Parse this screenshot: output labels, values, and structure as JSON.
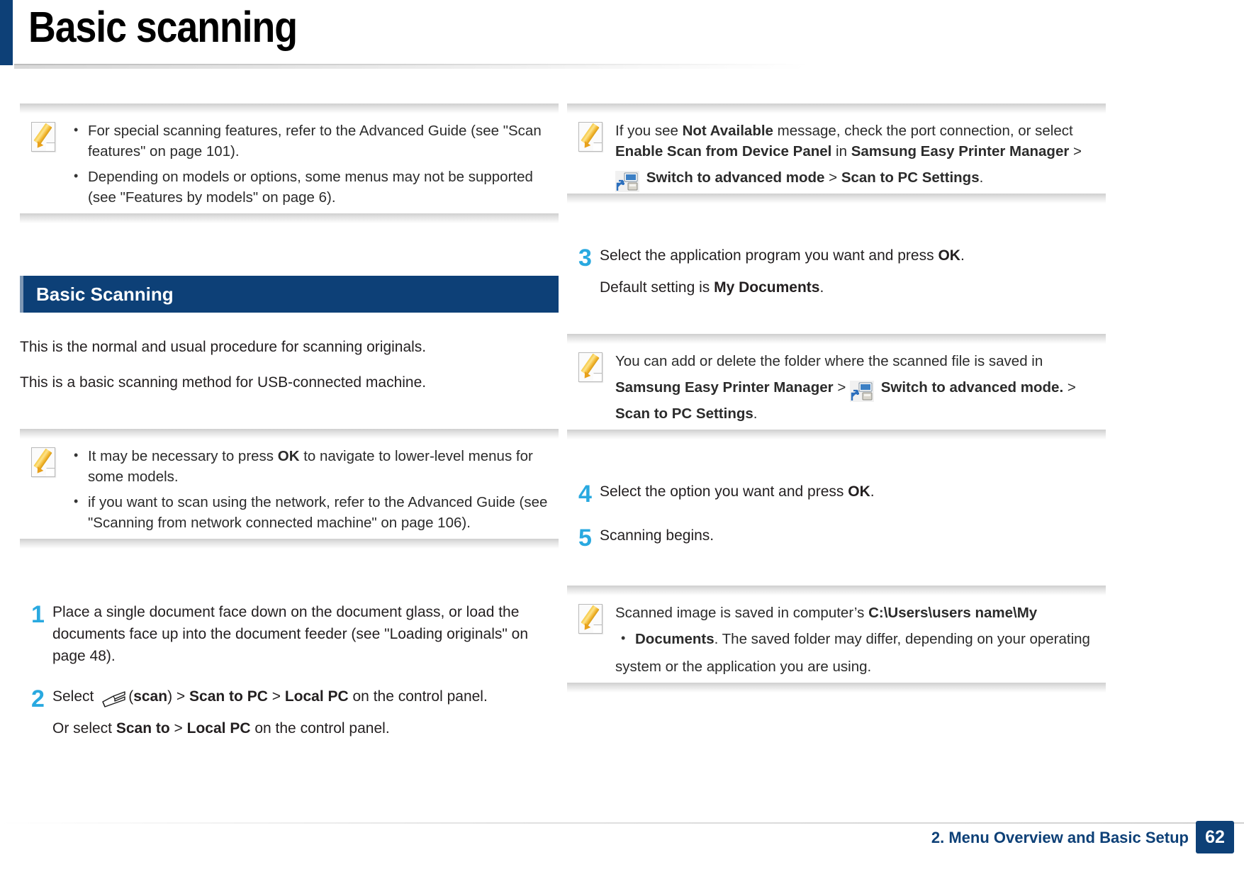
{
  "page": {
    "title": "Basic scanning",
    "footer_label": "2. Menu Overview and Basic Setup",
    "page_number": "62",
    "accent_blue": "#0d4077",
    "step_number_color": "#29a9e0"
  },
  "left": {
    "note_top": {
      "icon": "memo-note-icon",
      "bullets": [
        "For special scanning features, refer to the Advanced Guide (see \"Scan features\" on page 101).",
        "Depending on models or options, some menus may not be supported (see \"Features by models\" on page 6)."
      ]
    },
    "section_title": "Basic Scanning",
    "intro_paragraphs": [
      "This is the normal and usual procedure for scanning originals.",
      "This is a basic scanning method for USB-connected machine."
    ],
    "note_mid": {
      "icon": "memo-note-icon",
      "bullets": [
        {
          "parts": [
            {
              "t": "It may be necessary to press ",
              "b": false
            },
            {
              "t": "OK",
              "b": true
            },
            {
              "t": " to navigate to lower-level menus for some models.",
              "b": false
            }
          ]
        },
        {
          "parts": [
            {
              "t": "if you want to scan using the network, refer to the Advanced Guide (see \"Scanning from network connected machine\" on page 106).",
              "b": false
            }
          ]
        }
      ]
    },
    "steps": [
      {
        "num": "1",
        "lines": [
          {
            "parts": [
              {
                "t": "Place a single document face down on the document glass, or load the documents face up into the document feeder (see \"Loading originals\" on page 48).",
                "b": false
              }
            ]
          }
        ]
      },
      {
        "num": "2",
        "lines": [
          {
            "parts": [
              {
                "t": "Select ",
                "b": false
              },
              {
                "icon": "scanner-icon"
              },
              {
                "t": "(",
                "b": false
              },
              {
                "t": "scan",
                "b": true
              },
              {
                "t": ") > ",
                "b": false
              },
              {
                "t": "Scan to PC",
                "b": true
              },
              {
                "t": " > ",
                "b": false
              },
              {
                "t": "Local PC",
                "b": true
              },
              {
                "t": " on the control panel.",
                "b": false
              }
            ]
          },
          {
            "parts": [
              {
                "t": "Or select ",
                "b": false
              },
              {
                "t": "Scan to",
                "b": true
              },
              {
                "t": " > ",
                "b": false
              },
              {
                "t": "Local PC",
                "b": true
              },
              {
                "t": " on the control panel.",
                "b": false
              }
            ]
          }
        ]
      }
    ]
  },
  "right": {
    "note_not_available": {
      "icon": "memo-note-icon",
      "lines": [
        {
          "parts": [
            {
              "t": "If you see ",
              "b": false
            },
            {
              "t": "Not Available",
              "b": true
            },
            {
              "t": " message, check the port connection,  or select ",
              "b": false
            },
            {
              "t": "Enable Scan from Device Panel",
              "b": true
            },
            {
              "t": " in ",
              "b": false
            },
            {
              "t": "Samsung  Easy  Printer  Manager",
              "b": true
            },
            {
              "t": "  >",
              "b": false
            }
          ]
        },
        {
          "parts": [
            {
              "icon": "switch-advanced-mode-icon"
            },
            {
              "t": " Switch to advanced mode ",
              "b": true
            },
            {
              "t": " > ",
              "b": false
            },
            {
              "t": " Scan to PC Settings",
              "b": true
            },
            {
              "t": ".",
              "b": false
            }
          ]
        }
      ]
    },
    "steps": [
      {
        "num": "3",
        "lines": [
          {
            "parts": [
              {
                "t": "Select the application program you want and press ",
                "b": false
              },
              {
                "t": "OK",
                "b": true
              },
              {
                "t": ".",
                "b": false
              }
            ]
          },
          {
            "parts": [
              {
                "t": "Default setting is ",
                "b": false
              },
              {
                "t": "My Documents",
                "b": true
              },
              {
                "t": ".",
                "b": false
              }
            ]
          }
        ]
      }
    ],
    "note_folder": {
      "icon": "memo-note-icon",
      "lines": [
        {
          "parts": [
            {
              "t": "You can add or delete the folder where the scanned file is saved in",
              "b": false
            }
          ]
        },
        {
          "parts": [
            {
              "t": "Samsung  Easy  Printer  Manager",
              "b": true
            },
            {
              "t": "  >   ",
              "b": false
            },
            {
              "icon": "switch-advanced-mode-icon"
            },
            {
              "t": " Switch to advanced mode.",
              "b": true
            },
            {
              "t": "  > ",
              "b": false
            }
          ]
        },
        {
          "parts": [
            {
              "t": "Scan to PC Settings",
              "b": true
            },
            {
              "t": ".",
              "b": false
            }
          ]
        }
      ]
    },
    "steps2": [
      {
        "num": "4",
        "lines": [
          {
            "parts": [
              {
                "t": "Select the option you want and press ",
                "b": false
              },
              {
                "t": "OK",
                "b": true
              },
              {
                "t": ".",
                "b": false
              }
            ]
          }
        ]
      },
      {
        "num": "5",
        "lines": [
          {
            "parts": [
              {
                "t": "Scanning begins.",
                "b": false
              }
            ]
          }
        ]
      }
    ],
    "note_saved": {
      "icon": "memo-note-icon",
      "lines": [
        {
          "parts": [
            {
              "t": "Scanned image is saved in computer’s ",
              "b": false
            },
            {
              "t": "C:\\Users\\users name\\My",
              "b": true
            }
          ]
        }
      ],
      "bullet": {
        "parts": [
          {
            "t": "Documents",
            "b": true
          },
          {
            "t": ". The saved folder may differ, depending on your operating",
            "b": false
          }
        ]
      },
      "tail": {
        "parts": [
          {
            "t": "system or the application you are using.",
            "b": false
          }
        ]
      }
    }
  }
}
